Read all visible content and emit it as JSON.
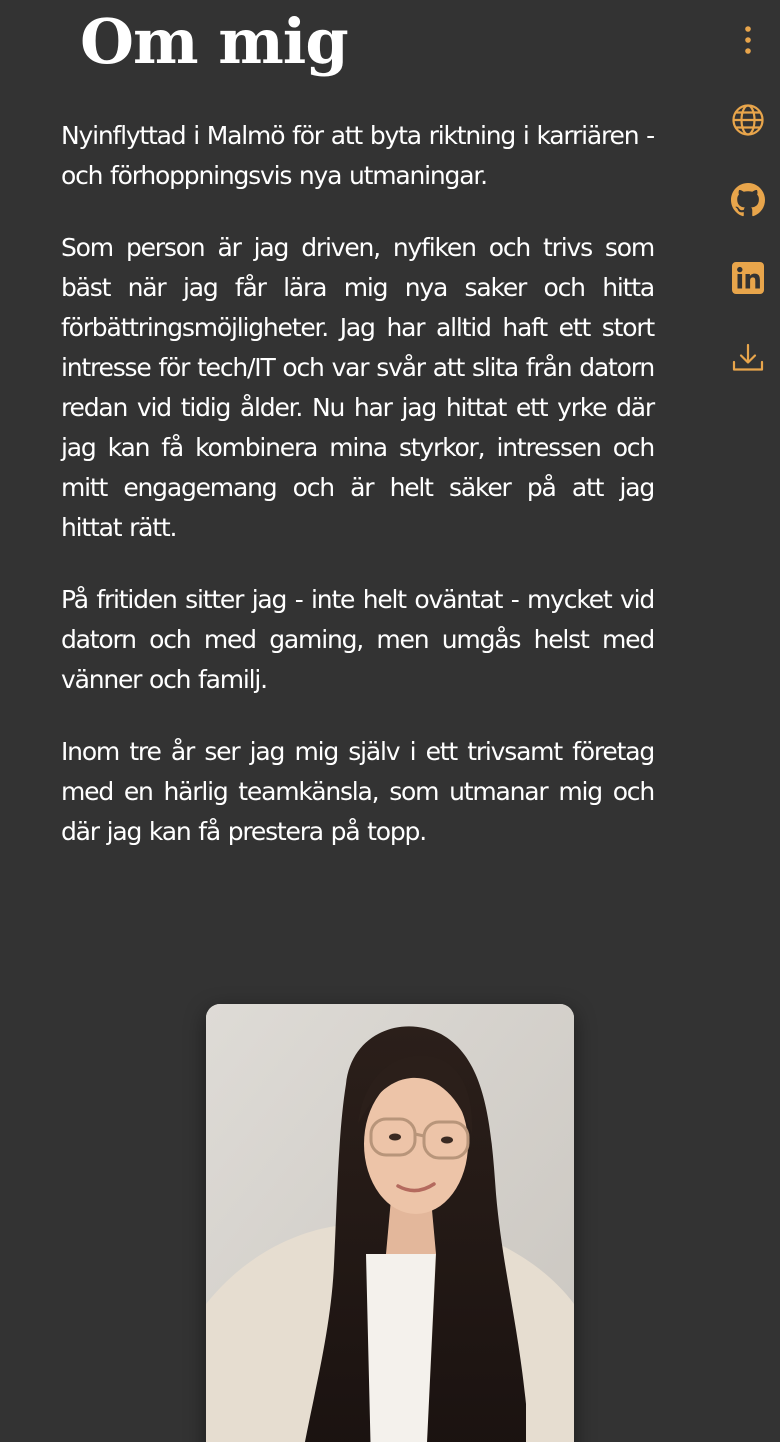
{
  "page": {
    "title": "Om mig"
  },
  "about": {
    "paragraphs": [
      "Nyinflyttad i Malmö för att byta riktning i karriären - och förhoppningsvis nya utmaningar.",
      "Som person är jag driven, nyfiken och trivs som bäst när jag får lära mig nya saker och hitta förbättringsmöjligheter. Jag har alltid haft ett stort intresse för tech/IT och var svår att slita från datorn redan vid tidig ålder. Nu har jag hittat ett yrke där jag kan få kombinera mina styrkor, intressen och mitt engagemang och är helt säker på att jag hittat rätt.",
      "På fritiden sitter jag - inte helt oväntat - mycket vid datorn och med gaming, men umgås helst med vänner och familj.",
      "Inom tre år ser jag mig själv i ett trivsamt företag med en härlig teamkänsla, som utmanar mig och där jag kan få prestera på topp."
    ]
  },
  "sidebar": {
    "icons": [
      "more-vertical-icon",
      "globe-icon",
      "github-icon",
      "linkedin-icon",
      "download-icon"
    ]
  },
  "portrait": {
    "subject": "portrait-photo"
  },
  "colors": {
    "background": "#333333",
    "text": "#ffffff",
    "accent": "#e8a54b"
  }
}
